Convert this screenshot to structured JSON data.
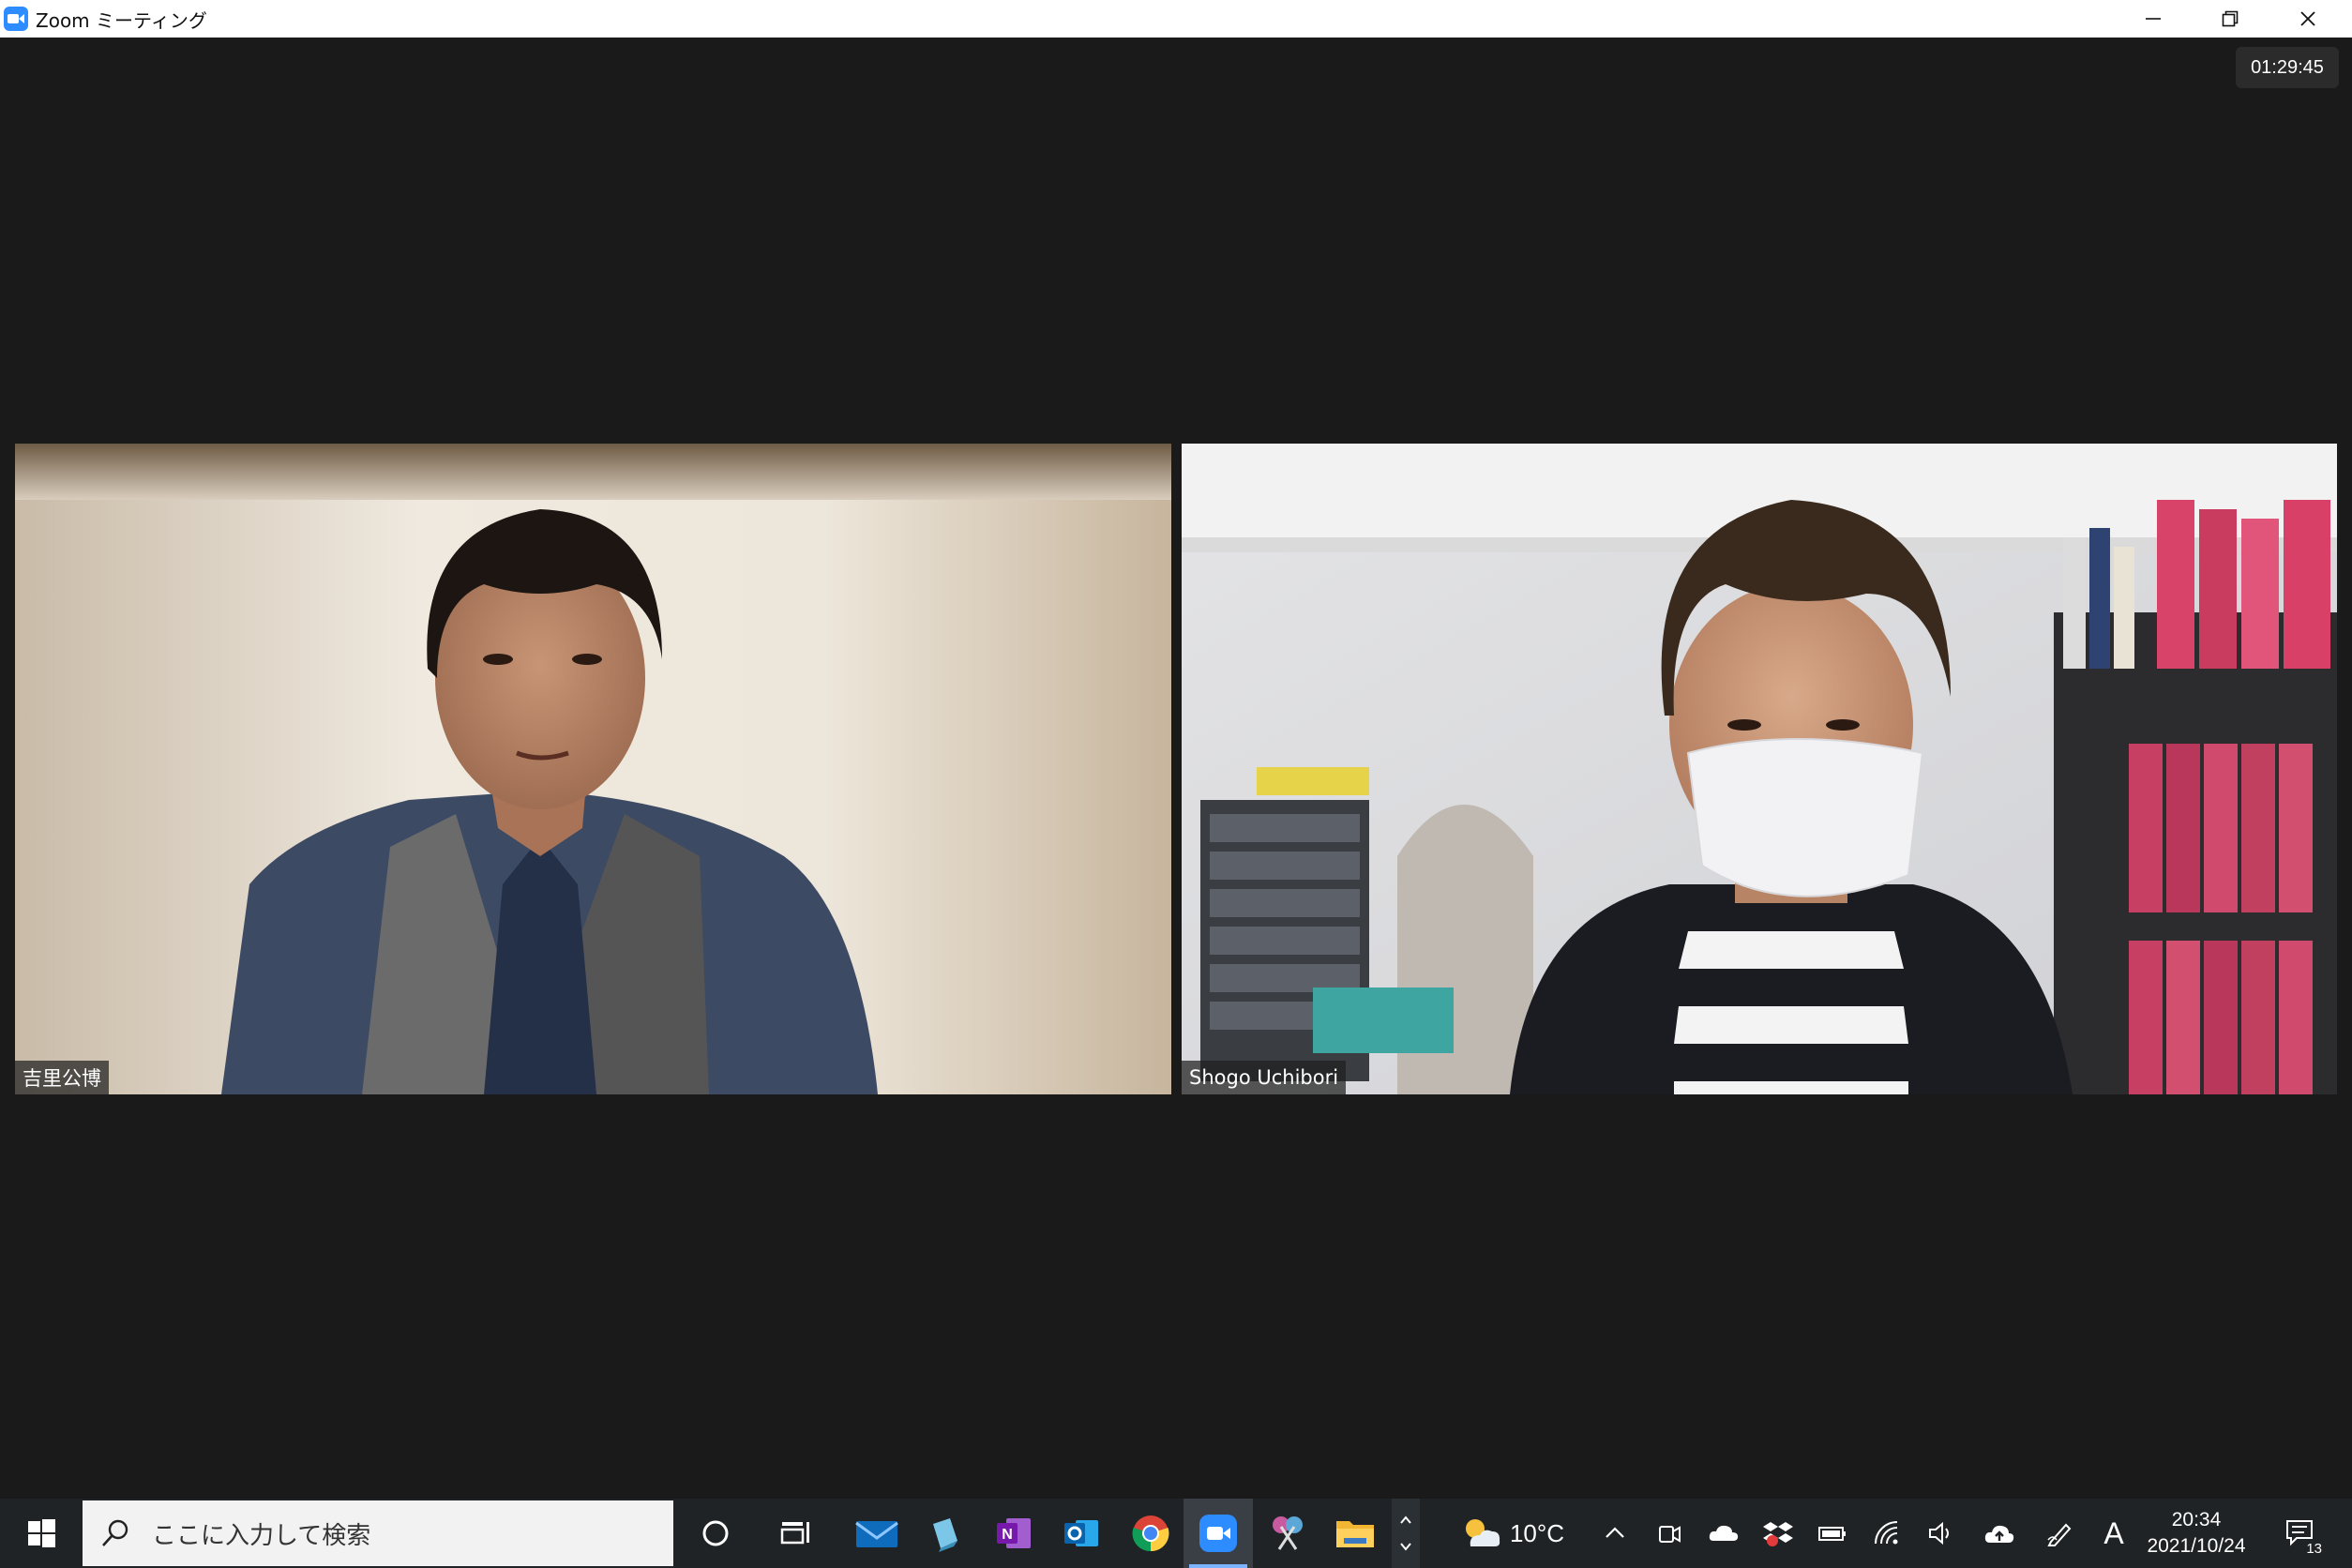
{
  "window": {
    "title": "Zoom ミーティング",
    "controls": [
      "minimize",
      "restore",
      "close"
    ]
  },
  "meeting": {
    "elapsed_time": "01:29:45",
    "participants": [
      {
        "name": "吉里公博"
      },
      {
        "name": "Shogo Uchibori"
      }
    ]
  },
  "taskbar": {
    "search_placeholder": "ここに入力して検索",
    "pinned_apps": [
      "cortana-icon",
      "task-view-icon",
      "mail-icon",
      "notepad-icon",
      "onenote-icon",
      "outlook-icon",
      "chrome-icon",
      "zoom-icon",
      "snipping-tool-icon",
      "file-explorer-icon"
    ],
    "active_app": "zoom-icon",
    "weather": {
      "temperature": "10°C",
      "icon": "partly-cloudy-icon"
    },
    "tray_icons": [
      "show-hidden-icons-chevron",
      "meet-now-icon",
      "onedrive-icon",
      "dropbox-icon",
      "battery-icon",
      "wifi-icon",
      "volume-icon",
      "upload-icon",
      "pen-icon",
      "ime-mode-icon"
    ],
    "ime_mode": "A",
    "clock": {
      "time": "20:34",
      "date": "2021/10/24"
    },
    "notifications": {
      "count": "13"
    }
  },
  "colors": {
    "background": "#1a1a1a",
    "zoom_blue": "#2d8cff",
    "taskbar": "#1f2326"
  }
}
